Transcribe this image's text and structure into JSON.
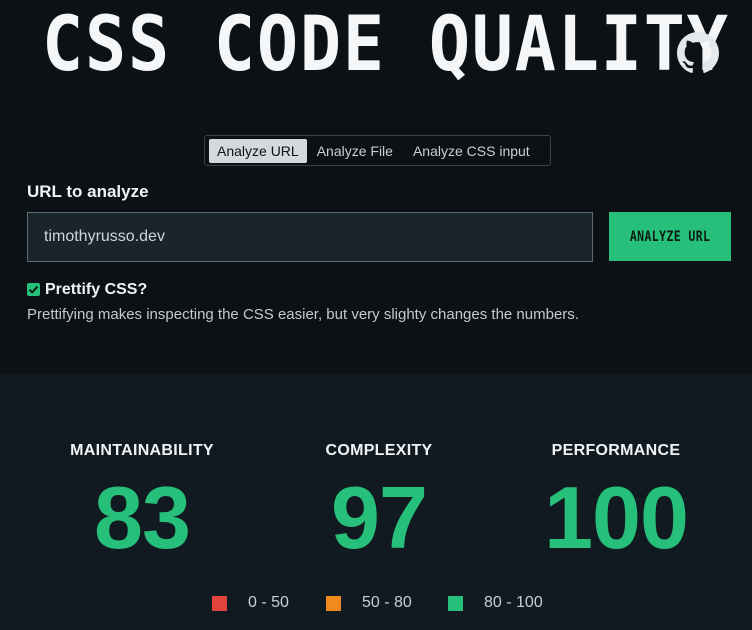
{
  "header": {
    "title": "CSS CODE QUALITY",
    "github_icon": "github-icon"
  },
  "tabs": [
    {
      "label": "Analyze URL",
      "active": true
    },
    {
      "label": "Analyze File",
      "active": false
    },
    {
      "label": "Analyze CSS input",
      "active": false
    }
  ],
  "form": {
    "url_label": "URL to analyze",
    "url_value": "timothyrusso.dev",
    "analyze_label": "ANALYZE URL",
    "prettify_label": "Prettify CSS?",
    "prettify_checked": true,
    "prettify_hint": "Prettifying makes inspecting the CSS easier, but very slighty changes the numbers."
  },
  "metrics": [
    {
      "label": "MAINTAINABILITY",
      "value": "83"
    },
    {
      "label": "COMPLEXITY",
      "value": "97"
    },
    {
      "label": "PERFORMANCE",
      "value": "100"
    }
  ],
  "legend": [
    {
      "range": "0 - 50",
      "color": "#e0443c"
    },
    {
      "range": "50 - 80",
      "color": "#f08a1c"
    },
    {
      "range": "80 - 100",
      "color": "#27c07a"
    }
  ],
  "colors": {
    "accent": "#27c07a",
    "background": "#0b1115",
    "panel": "#111a20"
  }
}
